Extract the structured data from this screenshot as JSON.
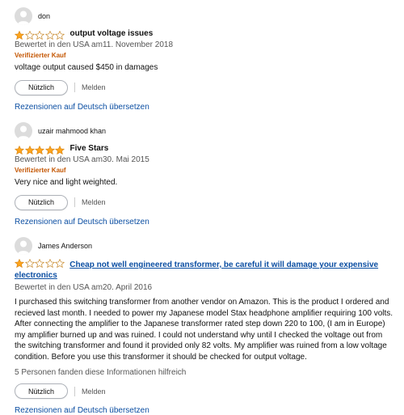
{
  "theme": {
    "star_color": "#ffa41c",
    "link_color": "#0b4ea2",
    "verified_color": "#c45500"
  },
  "reviews": [
    {
      "reviewer": "don",
      "rating": 1,
      "title": "output voltage issues",
      "date": "Bewertet in den USA am11. November 2018",
      "verified": "Verifizierter Kauf",
      "body": "voltage output caused $450 in damages",
      "helpful_button": "Nützlich",
      "report": "Melden",
      "translate": "Rezensionen auf Deutsch übersetzen"
    },
    {
      "reviewer": "uzair mahmood khan",
      "rating": 5,
      "title": "Five Stars",
      "date": "Bewertet in den USA am30. Mai 2015",
      "verified": "Verifizierter Kauf",
      "body": "Very nice and light weighted.",
      "helpful_button": "Nützlich",
      "report": "Melden",
      "translate": "Rezensionen auf Deutsch übersetzen"
    },
    {
      "reviewer": "James Anderson",
      "rating": 1,
      "title": "Cheap not well engineered transformer, be careful it will damage your expensive electronics",
      "date": "Bewertet in den USA am20. April 2016",
      "body": "I purchased this switching transformer from another vendor on Amazon. This is the product I ordered and recieved last month. I needed to power my Japanese model Stax headphone amplifier requiring 100 volts. After connecting the amplifier to the Japanese transformer rated step down 220 to 100, (I am in Europe) my amplifier burned up and was ruined. I could not understand why until I checked the voltage out from the switching transformer and found it provided only 82 volts. My amplifier was ruined from a low voltage condition. Before you use this transformer it should be checked for output voltage.",
      "helpful_count": "5 Personen fanden diese Informationen hilfreich",
      "helpful_button": "Nützlich",
      "report": "Melden",
      "translate": "Rezensionen auf Deutsch übersetzen"
    }
  ]
}
